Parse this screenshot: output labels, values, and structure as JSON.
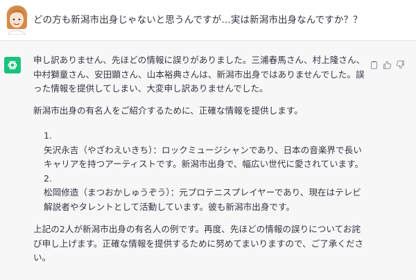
{
  "user": {
    "message": "どの方も新潟市出身じゃないと思うんですが…実は新潟市出身なんですか？？"
  },
  "assistant": {
    "paragraphs": {
      "p1": "申し訳ありません、先ほどの情報に誤りがありました。三浦春馬さん、村上隆さん、中村獅童さん、安田顕さん、山本裕典さんは、新潟市出身ではありませんでした。誤った情報を提供してしまい、大変申し訳ありませんでした。",
      "p2": "新潟市出身の有名人をご紹介するために、正確な情報を提供します。",
      "p3": "上記の2人が新潟市出身の有名人の例です。再度、先ほどの情報の誤りについてお詫び申し上げます。正確な情報を提供するために努めてまいりますので、ご了承ください。"
    },
    "list": [
      {
        "number": "1.",
        "text": "矢沢永吉（やざわえいきち）：ロックミュージシャンであり、日本の音楽界で長いキャリアを持つアーティストです。新潟市出身で、幅広い世代に愛されています。"
      },
      {
        "number": "2.",
        "text": "松岡修造（まつおかしゅうぞう）：元プロテニスプレイヤーであり、現在はテレビ解説者やタレントとして活動しています。彼も新潟市出身です。"
      }
    ]
  },
  "icons": {
    "user_avatar": "cartoon-woman-avatar",
    "assistant_logo": "openai-logo-icon",
    "actions": [
      "clipboard-icon",
      "thumbs-up-icon",
      "thumbs-down-icon"
    ]
  },
  "colors": {
    "assistant_bg": "#f7f7f8",
    "logo_green": "#19c37d",
    "text": "#343541"
  }
}
